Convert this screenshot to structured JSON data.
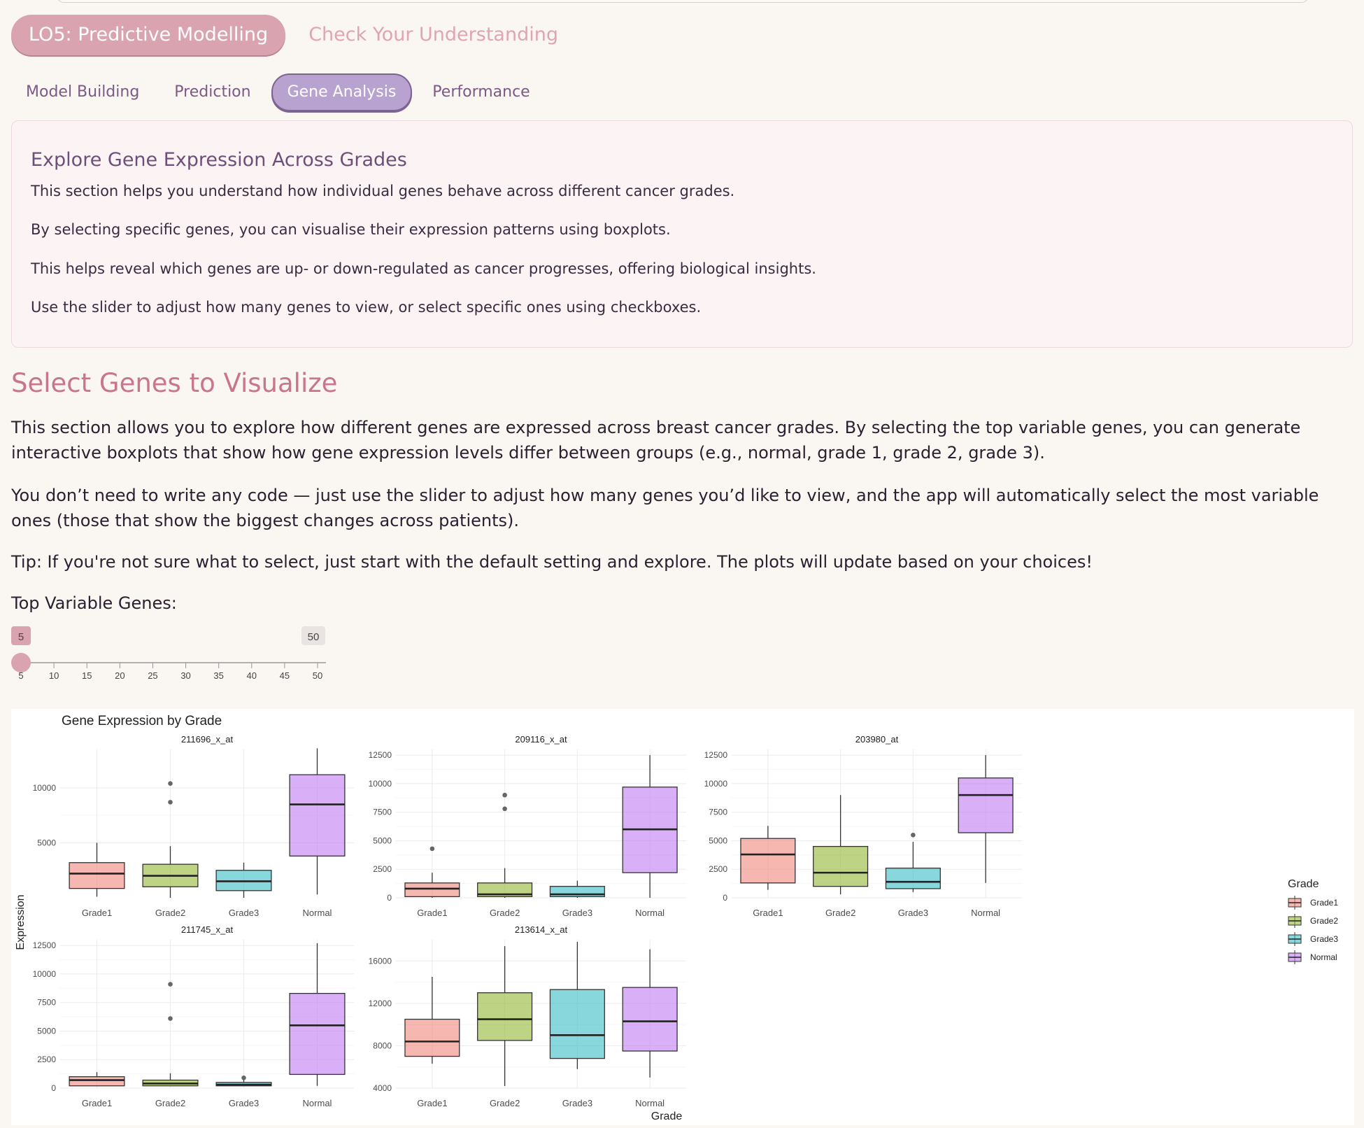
{
  "tabs": {
    "main": [
      {
        "label": "LO5: Predictive Modelling"
      },
      {
        "label": "Check Your Understanding"
      }
    ],
    "sub": [
      {
        "label": "Model Building"
      },
      {
        "label": "Prediction"
      },
      {
        "label": "Gene Analysis"
      },
      {
        "label": "Performance"
      }
    ]
  },
  "info": {
    "title": "Explore Gene Expression Across Grades",
    "paragraphs": [
      "This section helps you understand how individual genes behave across different cancer grades.",
      "By selecting specific genes, you can visualise their expression patterns using boxplots.",
      "This helps reveal which genes are up- or down-regulated as cancer progresses, offering biological insights.",
      "Use the slider to adjust how many genes to view, or select specific ones using checkboxes."
    ]
  },
  "section": {
    "title": "Select Genes to Visualize",
    "paragraphs": [
      "This section allows you to explore how different genes are expressed across breast cancer grades. By selecting the top variable genes, you can generate interactive boxplots that show how gene expression levels differ between groups (e.g., normal, grade 1, grade 2, grade 3).",
      "You don’t need to write any code — just use the slider to adjust how many genes you’d like to view, and the app will automatically select the most variable ones (those that show the biggest changes across patients).",
      "Tip: If you're not sure what to select, just start with the default setting and explore. The plots will update based on your choices!"
    ]
  },
  "slider": {
    "label": "Top Variable Genes:",
    "value": 5,
    "min": 5,
    "max": 50,
    "value_label": "5",
    "max_label": "50",
    "ticks": [
      "5",
      "10",
      "15",
      "20",
      "25",
      "30",
      "35",
      "40",
      "45",
      "50"
    ],
    "color": "#d9a3b0"
  },
  "colors": {
    "accent": "#d9a3b0",
    "grade1": "#f08b80",
    "grade2": "#97b83a",
    "grade3": "#3fbfc6",
    "normal": "#c27ef2"
  },
  "chart_data": {
    "type": "boxplot",
    "title": "Gene Expression by Grade",
    "xlabel": "Grade",
    "ylabel": "Expression",
    "categories": [
      "Grade1",
      "Grade2",
      "Grade3",
      "Normal"
    ],
    "legend": {
      "title": "Grade",
      "entries": [
        "Grade1",
        "Grade2",
        "Grade3",
        "Normal"
      ],
      "placement": "right"
    },
    "grid": true,
    "facets": [
      {
        "name": "211696_x_at",
        "ylim": [
          0,
          13500
        ],
        "yticks": [
          5000,
          10000
        ],
        "boxes": [
          {
            "min": 100,
            "q1": 850,
            "median": 2200,
            "q3": 3200,
            "max": 5000,
            "outliers": []
          },
          {
            "min": 0,
            "q1": 1000,
            "median": 2000,
            "q3": 3050,
            "max": 4700,
            "outliers": [
              8700,
              10400
            ]
          },
          {
            "min": 0,
            "q1": 650,
            "median": 1500,
            "q3": 2500,
            "max": 3200,
            "outliers": []
          },
          {
            "min": 300,
            "q1": 3800,
            "median": 8500,
            "q3": 11200,
            "max": 13600,
            "outliers": []
          }
        ]
      },
      {
        "name": "209116_x_at",
        "ylim": [
          0,
          13000
        ],
        "yticks": [
          0,
          2500,
          5000,
          7500,
          10000,
          12500
        ],
        "boxes": [
          {
            "min": 0,
            "q1": 100,
            "median": 800,
            "q3": 1300,
            "max": 2200,
            "outliers": [
              4300
            ]
          },
          {
            "min": 0,
            "q1": 100,
            "median": 300,
            "q3": 1300,
            "max": 2600,
            "outliers": [
              7800,
              9000
            ]
          },
          {
            "min": 0,
            "q1": 100,
            "median": 300,
            "q3": 1000,
            "max": 1500,
            "outliers": []
          },
          {
            "min": 0,
            "q1": 2200,
            "median": 6000,
            "q3": 9700,
            "max": 12500,
            "outliers": []
          }
        ]
      },
      {
        "name": "203980_at",
        "ylim": [
          0,
          13000
        ],
        "yticks": [
          0,
          2500,
          5000,
          7500,
          10000,
          12500
        ],
        "boxes": [
          {
            "min": 700,
            "q1": 1300,
            "median": 3800,
            "q3": 5200,
            "max": 6300,
            "outliers": []
          },
          {
            "min": 300,
            "q1": 1000,
            "median": 2200,
            "q3": 4500,
            "max": 9000,
            "outliers": []
          },
          {
            "min": 500,
            "q1": 800,
            "median": 1400,
            "q3": 2600,
            "max": 4900,
            "outliers": [
              5500
            ]
          },
          {
            "min": 1300,
            "q1": 5700,
            "median": 9000,
            "q3": 10500,
            "max": 12500,
            "outliers": []
          }
        ]
      },
      {
        "name": "211745_x_at",
        "ylim": [
          0,
          13000
        ],
        "yticks": [
          0,
          2500,
          5000,
          7500,
          10000,
          12500
        ],
        "boxes": [
          {
            "min": 200,
            "q1": 200,
            "median": 700,
            "q3": 1000,
            "max": 1400,
            "outliers": []
          },
          {
            "min": 200,
            "q1": 200,
            "median": 400,
            "q3": 700,
            "max": 1300,
            "outliers": [
              6100,
              9100
            ]
          },
          {
            "min": 200,
            "q1": 200,
            "median": 300,
            "q3": 500,
            "max": 900,
            "outliers": [
              900
            ]
          },
          {
            "min": 200,
            "q1": 1200,
            "median": 5500,
            "q3": 8300,
            "max": 12700,
            "outliers": []
          }
        ]
      },
      {
        "name": "213614_x_at",
        "ylim": [
          4000,
          18000
        ],
        "yticks": [
          4000,
          8000,
          12000,
          16000
        ],
        "boxes": [
          {
            "min": 6300,
            "q1": 7000,
            "median": 8400,
            "q3": 10500,
            "max": 14500,
            "outliers": []
          },
          {
            "min": 4200,
            "q1": 8500,
            "median": 10500,
            "q3": 13000,
            "max": 17400,
            "outliers": []
          },
          {
            "min": 5800,
            "q1": 6800,
            "median": 9000,
            "q3": 13300,
            "max": 17800,
            "outliers": []
          },
          {
            "min": 5000,
            "q1": 7500,
            "median": 10300,
            "q3": 13500,
            "max": 17100,
            "outliers": []
          }
        ]
      }
    ]
  }
}
